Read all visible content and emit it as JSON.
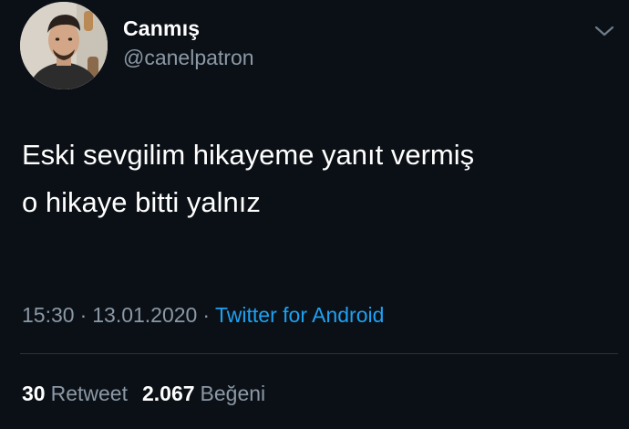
{
  "user": {
    "display_name": "Canmış",
    "handle": "@canelpatron"
  },
  "tweet": {
    "lines": [
      "Eski sevgilim hikayeme yanıt vermiş",
      "o hikaye bitti yalnız"
    ],
    "time": "15:30",
    "date": "13.01.2020",
    "separator": "·",
    "source": "Twitter for Android"
  },
  "stats": {
    "retweets": "30",
    "retweets_label": "Retweet",
    "likes": "2.067",
    "likes_label": "Beğeni"
  },
  "icons": {
    "menu": "chevron-down-icon",
    "avatar": "avatar"
  },
  "colors": {
    "background": "#0b1016",
    "text": "#ffffff",
    "secondary": "#8b98a5",
    "link": "#1da1f2",
    "divider": "#2a333d"
  }
}
